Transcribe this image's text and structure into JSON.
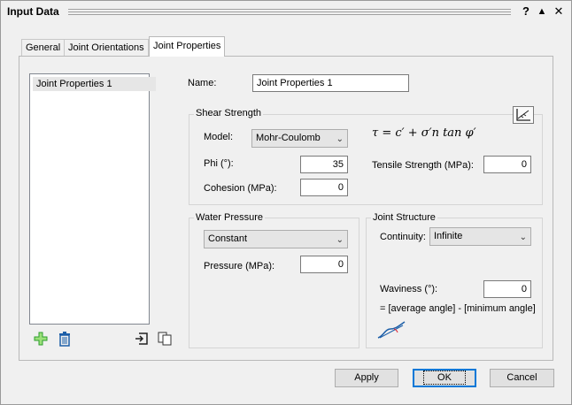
{
  "window": {
    "title": "Input Data",
    "help_glyph": "?",
    "collapse_glyph": "▲",
    "close_glyph": "✕"
  },
  "tabs": [
    {
      "label": "General"
    },
    {
      "label": "Joint Orientations"
    },
    {
      "label": "Joint Properties"
    }
  ],
  "active_tab": "Joint Properties",
  "list": {
    "items": [
      "Joint Properties 1"
    ],
    "selected": "Joint Properties 1"
  },
  "list_toolbar": {
    "add_icon": "plus-icon",
    "delete_icon": "trash-icon",
    "import_icon": "import-icon",
    "copy_icon": "copy-icon"
  },
  "name": {
    "label": "Name:",
    "value": "Joint Properties 1"
  },
  "shear_strength": {
    "title": "Shear Strength",
    "plot_icon": "chart-icon",
    "model_label": "Model:",
    "model_value": "Mohr-Coulomb",
    "formula": "τ = c′ + σ′n tan φ′",
    "phi_label": "Phi (°):",
    "phi_value": "35",
    "cohesion_label": "Cohesion (MPa):",
    "cohesion_value": "0",
    "tensile_label": "Tensile Strength (MPa):",
    "tensile_value": "0"
  },
  "water_pressure": {
    "title": "Water Pressure",
    "mode_value": "Constant",
    "pressure_label": "Pressure (MPa):",
    "pressure_value": "0"
  },
  "joint_structure": {
    "title": "Joint Structure",
    "continuity_label": "Continuity:",
    "continuity_value": "Infinite",
    "waviness_label": "Waviness (°):",
    "waviness_value": "0",
    "waviness_note": "= [average angle] - [minimum angle]"
  },
  "buttons": {
    "apply": "Apply",
    "ok": "OK",
    "cancel": "Cancel"
  },
  "colors": {
    "accent": "#0078d7",
    "add_green": "#2e9e2e",
    "delete_blue": "#1d5fa8"
  }
}
